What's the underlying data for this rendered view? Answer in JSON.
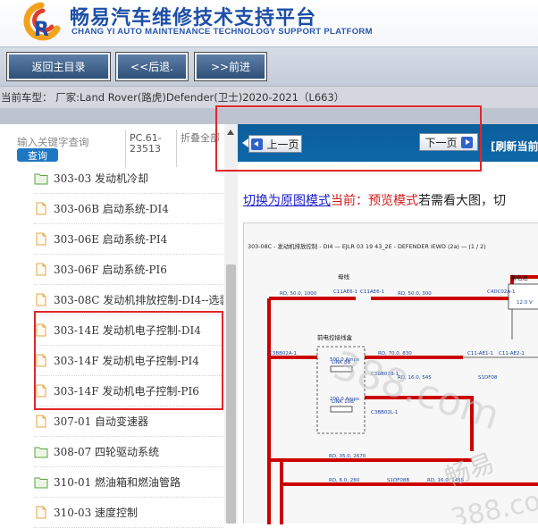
{
  "header": {
    "title_cn": "畅易汽车维修技术支持平台",
    "title_en": "CHANG YI AUTO MAINTENANCE TECHNOLOGY SUPPORT PLATFORM"
  },
  "toolbar": {
    "home": "返回主目录",
    "back": "<<后退.",
    "forward": ">>前进"
  },
  "vehicle": "当前车型： 厂家:Land Rover(路虎)Defender(卫士)2020-2021（L663）",
  "left_panel": {
    "search_placeholder": "输入关键字查询",
    "search_button": "查询",
    "pc_code": "PC.61-23513",
    "fold_all": "折叠全部",
    "tree_items": [
      {
        "label": "303-03 发动机冷却",
        "icon": "folder-icon"
      },
      {
        "label": "303-06B 启动系统-DI4",
        "icon": "document-icon"
      },
      {
        "label": "303-06E 启动系统-PI4",
        "icon": "document-icon"
      },
      {
        "label": "303-06F 启动系统-PI6",
        "icon": "document-icon"
      },
      {
        "label": "303-08C 发动机排放控制-DI4--选装",
        "icon": "document-icon"
      },
      {
        "label": "303-14E 发动机电子控制-DI4",
        "icon": "document-icon"
      },
      {
        "label": "303-14F 发动机电子控制-PI4",
        "icon": "document-icon"
      },
      {
        "label": "303-14F 发动机电子控制-PI6",
        "icon": "document-icon"
      },
      {
        "label": "307-01 自动变速器",
        "icon": "document-icon"
      },
      {
        "label": "308-07 四轮驱动系统",
        "icon": "folder-icon"
      },
      {
        "label": "310-01 燃油箱和燃油管路",
        "icon": "folder-icon"
      },
      {
        "label": "310-03 速度控制",
        "icon": "document-icon"
      }
    ]
  },
  "viewer": {
    "prev_page": "上一页",
    "next_page": "下一页",
    "refresh": "[刷新当前",
    "mode_link": "切换为原图模式",
    "mode_current": "当前：预览模式",
    "mode_hint": "若需看大图，切"
  },
  "diagram": {
    "title": "303-08C - 发动机排放控制 - DI4 — EJLR 03 19 43_2E - DEFENDER iEWD (2a) — (1 / 2)",
    "labels": [
      "母线",
      "蓄电池",
      "前电控接线盒",
      "C11AE6-1",
      "C11AE6-1",
      "C4DC02A-1",
      "RD, 50.0, 1000",
      "RD, 50.0, 300",
      "C3BB02A-1",
      "C11-AE1-1",
      "C11-AE2-1",
      "RD, 70.0, 830",
      "LINK 8B",
      "500.0 Amps",
      "C3BB02B-1",
      "RD, 16.0, 545",
      "S1DF08",
      "200.0 Amps",
      "LINK 10B",
      "C3BB02L-1",
      "RD, 35.0, 2670",
      "RD, 6.0, 280",
      "S1DF08B",
      "RD, 16.0, 1455",
      "12.0 V"
    ],
    "watermark": "388.com",
    "watermark_cn": "畅易"
  },
  "colors": {
    "brand_blue": "#1d4fa8",
    "nav_blue": "#0b5e9c",
    "highlight_red": "#e0262a",
    "wire_red": "#cc0000"
  }
}
